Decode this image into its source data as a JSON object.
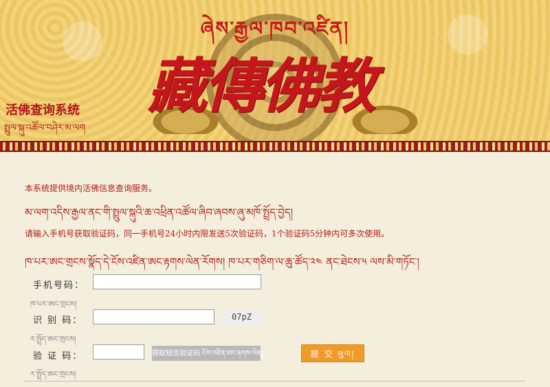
{
  "header": {
    "tibetan_title": "ཞེས་རྒྱལ་ཁབ་འཛིན།",
    "main_title": "藏傳佛教",
    "app_name": "活佛查询系统",
    "app_name_tibetan": "སྤྲུལ་སྐུ་འཚོལ་བཤེར་མ་ལག"
  },
  "intro": {
    "line1": "本系统提供境内活佛信息查询服务。",
    "line2": "མ་ལག་འདིས་རྒྱལ་ནང་གི་སྤྲུལ་སྐུའི་ཆ་འཕྲིན་འཚོལ་ཞིབ་ཞབས་ཞུ་མཁོ་སྤྲོད་བྱེད།",
    "line3": "请输入手机号获取验证码，同一手机号24小时内限发送5次验证码，1个验证码5分钟内可多次使用。",
    "line4": "ཁ་པར་ཨང་གྲངས་སྣོད་དེ་ངོས་འཛིན་ཨང་རྟགས་ལེན་རོགས། ཁ་པར་གཅིག་ལ་ཆུ་ཚོད་༢༤ ནང་ཐེངས་༥ ལས་མི་གཏོང་།"
  },
  "form": {
    "phone_label": "手机号码：",
    "phone_sublabel": "ཁ་པར་ཨང་གྲངས།",
    "phone_value": "",
    "captcha_label": "识 别 码：",
    "captcha_sublabel": "ར་སྤྲོད་ཨང་གྲངས།",
    "captcha_value": "",
    "captcha_text": "07pZ",
    "code_label": "验 证 码：",
    "code_sublabel": "ར་སྤྲོད་ཨང་གྲངས།",
    "code_value": "",
    "sms_button": "获取短信验证码 ངོས་འཛིན་ཨང་རྟགས་ལེན།",
    "submit_button": "提 交 ཕུལ།"
  },
  "colors": {
    "accent_red": "#b41a1a",
    "submit_orange": "#f09a2a",
    "background": "#f3efdc",
    "banner_gold": "#eec865"
  }
}
